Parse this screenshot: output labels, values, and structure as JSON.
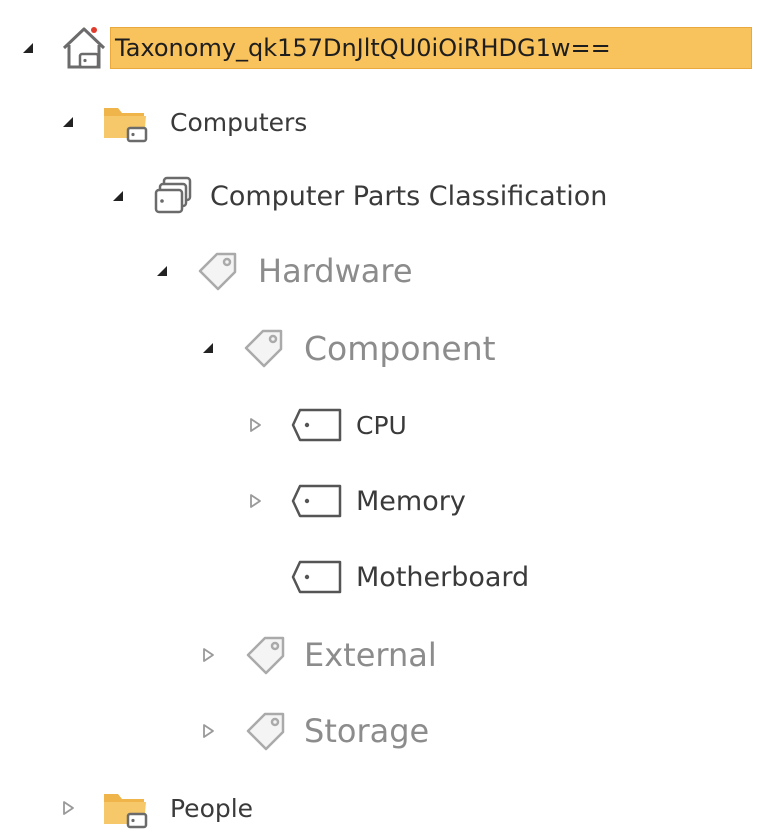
{
  "tree": {
    "root": {
      "label": "Taxonomy_qk157DnJltQU0iOiRHDG1w==",
      "icon": "term-store-home-icon",
      "expanded": true,
      "selected": true
    },
    "group_computers": {
      "label": "Computers",
      "icon": "folder-group-icon",
      "expanded": true
    },
    "termset": {
      "label": "Computer Parts Classification",
      "icon": "term-set-icon",
      "expanded": true
    },
    "term_hardware": {
      "label": "Hardware",
      "icon": "term-tag-icon",
      "expanded": true
    },
    "term_component": {
      "label": "Component",
      "icon": "term-tag-icon",
      "expanded": true
    },
    "term_cpu": {
      "label": "CPU",
      "icon": "term-label-icon",
      "expanded": false
    },
    "term_memory": {
      "label": "Memory",
      "icon": "term-label-icon",
      "expanded": false
    },
    "term_motherboard": {
      "label": "Motherboard",
      "icon": "term-label-icon"
    },
    "term_external": {
      "label": "External",
      "icon": "term-tag-icon",
      "expanded": false
    },
    "term_storage": {
      "label": "Storage",
      "icon": "term-tag-icon",
      "expanded": false
    },
    "group_people": {
      "label": "People",
      "icon": "folder-group-icon",
      "expanded": false
    }
  },
  "colors": {
    "selected_background": "#f8c25c",
    "selected_border": "#e9a93d",
    "folder": "#f0b54a",
    "text": "#3a3a3a",
    "text_light": "#8c8c8c"
  }
}
